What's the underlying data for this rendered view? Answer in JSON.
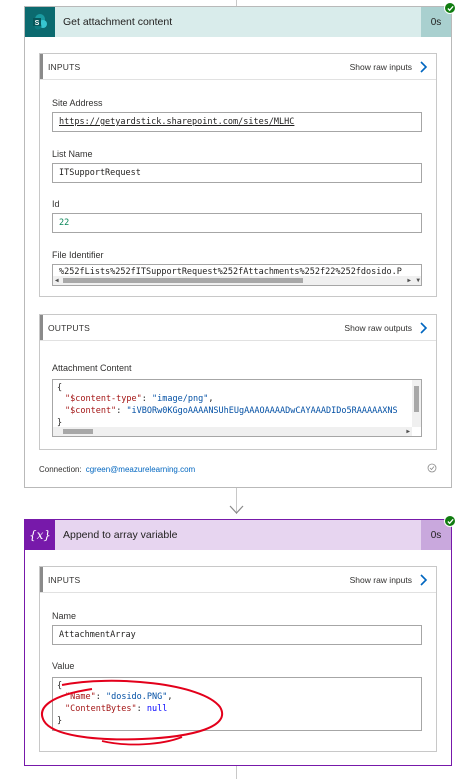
{
  "action1": {
    "title": "Get attachment content",
    "duration": "0s",
    "icon": "sharepoint-icon",
    "color": "#0b6a6f",
    "inputs": {
      "header": "INPUTS",
      "raw_label": "Show raw inputs",
      "site_address_label": "Site Address",
      "site_address_value": "https://getyardstick.sharepoint.com/sites/MLHC",
      "list_name_label": "List Name",
      "list_name_value": "ITSupportRequest",
      "id_label": "Id",
      "id_value": "22",
      "file_identifier_label": "File Identifier",
      "file_identifier_value": "%252fLists%252fITSupportRequest%252fAttachments%252f22%252fdosido.P"
    },
    "outputs": {
      "header": "OUTPUTS",
      "raw_label": "Show raw outputs",
      "attachment_content_label": "Attachment Content",
      "code": {
        "open": "{",
        "line1_key": "\"$content-type\"",
        "line1_val": "\"image/png\"",
        "line2_key": "\"$content\"",
        "line2_val": "\"iVBORw0KGgoAAAANSUhEUgAAAOAAAADwCAYAAADIDo5RAAAAAXNS",
        "close": "}"
      }
    },
    "connection_label": "Connection:",
    "connection_value": "cgreen@meazurelearning.com"
  },
  "action2": {
    "title": "Append to array variable",
    "duration": "0s",
    "icon": "variable-icon",
    "color": "#7719aa",
    "inputs": {
      "header": "INPUTS",
      "raw_label": "Show raw inputs",
      "name_label": "Name",
      "name_value": "AttachmentArray",
      "value_label": "Value",
      "code": {
        "open": "{",
        "line1_key": "\"Name\"",
        "line1_val": "\"dosido.PNG\"",
        "line2_key": "\"ContentBytes\"",
        "line2_val": "null",
        "close": "}"
      }
    }
  },
  "colors": {
    "success": "#107c10",
    "link": "#0066c0",
    "annotation": "#e3001b"
  }
}
